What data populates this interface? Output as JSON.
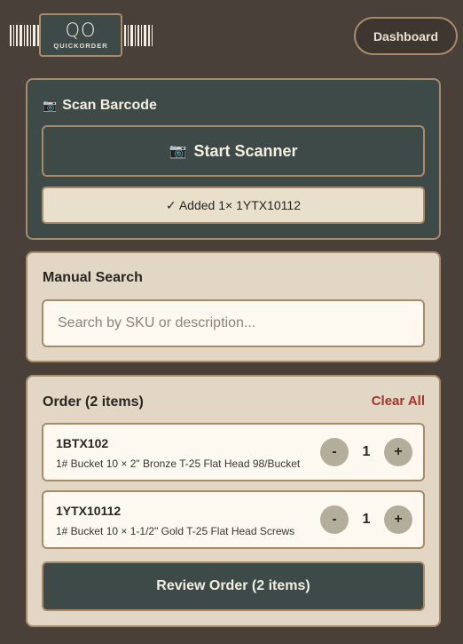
{
  "header": {
    "logo_mark": "QO",
    "logo_sub": "QUICKORDER",
    "dashboard_label": "Dashboard"
  },
  "scan": {
    "title": "Scan Barcode",
    "title_icon": "camera-icon",
    "start_label": "Start Scanner",
    "added_message": "✓ Added 1× 1YTX10112"
  },
  "search": {
    "title": "Manual Search",
    "placeholder": "Search by SKU or description..."
  },
  "order": {
    "title": "Order (2 items)",
    "clear_label": "Clear All",
    "items": [
      {
        "sku": "1BTX102",
        "description": "1# Bucket 10 × 2\" Bronze T-25 Flat Head 98/Bucket",
        "qty": "1",
        "minus": "-",
        "plus": "+"
      },
      {
        "sku": "1YTX10112",
        "description": "1# Bucket 10 × 1-1/2\" Gold T-25 Flat Head Screws",
        "qty": "1",
        "minus": "-",
        "plus": "+"
      }
    ],
    "review_label": "Review Order (2 items)"
  },
  "colors": {
    "background": "#4a403a",
    "teal": "#3d4a48",
    "beige": "#e1d7c4",
    "border": "#a98a69",
    "clear_red": "#a9322a"
  }
}
